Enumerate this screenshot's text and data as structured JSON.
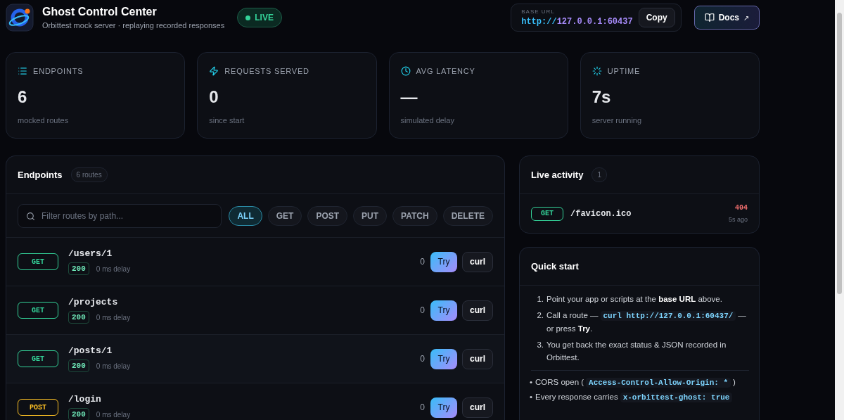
{
  "header": {
    "title": "Ghost Control Center",
    "subtitle": "Orbittest mock server · replaying recorded responses",
    "status": {
      "label": "LIVE",
      "on": true
    },
    "base_url": {
      "label": "BASE URL",
      "scheme": "http://",
      "host": "127.0.0.1:60437",
      "copy_button": "Copy"
    },
    "docs_button": {
      "label": "Docs",
      "arrow": "↗"
    }
  },
  "stats": [
    {
      "kind": "endpoints",
      "label": "ENDPOINTS",
      "value": "6",
      "caption": "mocked routes"
    },
    {
      "kind": "requests",
      "label": "REQUESTS SERVED",
      "value": "0",
      "caption": "since start"
    },
    {
      "kind": "latency",
      "label": "AVG LATENCY",
      "value": "—",
      "caption": "simulated delay"
    },
    {
      "kind": "uptime",
      "label": "UPTIME",
      "value": "7s",
      "caption": "server running"
    }
  ],
  "endpoints": {
    "title": "Endpoints",
    "count": "6 routes",
    "search": {
      "placeholder": "Filter routes by path..."
    },
    "filters": [
      {
        "label": "ALL",
        "selected": true
      },
      {
        "label": "GET",
        "selected": false
      },
      {
        "label": "POST",
        "selected": false
      },
      {
        "label": "PUT",
        "selected": false
      },
      {
        "label": "PATCH",
        "selected": false
      },
      {
        "label": "DELETE",
        "selected": false
      }
    ],
    "rows": [
      {
        "method": "GET",
        "color": "#34d399",
        "path": "/users/1",
        "status": "200",
        "delay": "0 ms delay",
        "hits": "0",
        "try": "Try",
        "curl": "curl"
      },
      {
        "method": "GET",
        "color": "#34d399",
        "path": "/projects",
        "status": "200",
        "delay": "0 ms delay",
        "hits": "0",
        "try": "Try",
        "curl": "curl"
      },
      {
        "method": "GET",
        "color": "#34d399",
        "path": "/posts/1",
        "status": "200",
        "delay": "0 ms delay",
        "hits": "0",
        "try": "Try",
        "curl": "curl"
      },
      {
        "method": "POST",
        "color": "#fbbf24",
        "path": "/login",
        "status": "200",
        "delay": "0 ms delay",
        "hits": "0",
        "try": "Try",
        "curl": "curl"
      }
    ]
  },
  "live_activity": {
    "title": "Live activity",
    "count": "1",
    "items": [
      {
        "method": "GET",
        "color": "#34d399",
        "path": "/favicon.ico",
        "status": "404",
        "time": "5s ago"
      }
    ]
  },
  "quick_start": {
    "title": "Quick start",
    "steps": [
      {
        "number": "1.",
        "parts": [
          {
            "kind": "text",
            "text": "Point your app or scripts at the **base URL** above."
          }
        ]
      },
      {
        "number": "2.",
        "parts": [
          {
            "kind": "text",
            "text": "Call a route —"
          },
          {
            "kind": "code",
            "text": "curl http://127.0.0.1:60437/"
          },
          {
            "kind": "text",
            "text": "—"
          },
          {
            "kind": "text",
            "text": "or press **Try**."
          }
        ]
      },
      {
        "number": "3.",
        "parts": [
          {
            "kind": "text",
            "text": "You get back the exact status & JSON recorded in Orbittest."
          }
        ]
      }
    ],
    "notes": [
      {
        "bullet": "•",
        "parts": [
          {
            "kind": "text",
            "text": "CORS open ("
          },
          {
            "kind": "code",
            "text": "Access-Control-Allow-Origin: *"
          },
          {
            "kind": "text",
            "text": ")"
          }
        ]
      },
      {
        "bullet": "•",
        "parts": [
          {
            "kind": "text",
            "text": "Every response carries"
          },
          {
            "kind": "code",
            "text": "x-orbittest-ghost: true"
          }
        ]
      }
    ]
  }
}
